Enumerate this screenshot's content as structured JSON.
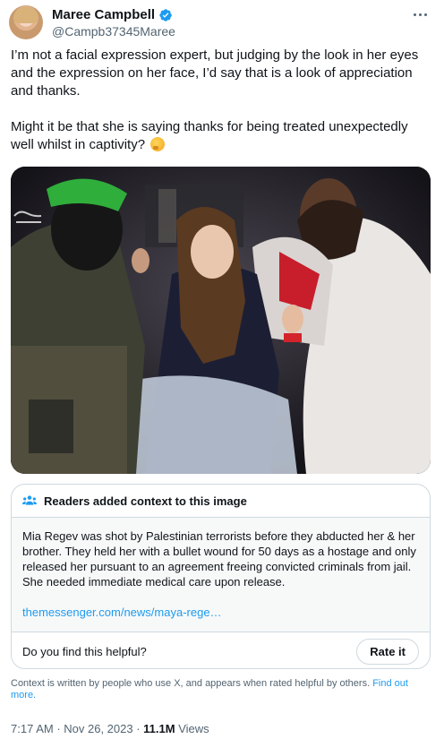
{
  "author": {
    "display_name": "Maree Campbell",
    "handle": "@Campb37345Maree",
    "verified": true
  },
  "icons": {
    "verified": "verified-badge-icon",
    "more": "more-options-icon",
    "note": "people-icon",
    "emoji": "thinking-face-emoji"
  },
  "tweet": {
    "text_p1": "I’m not a facial expression expert, but judging by the look in her eyes and the expression on her face, I’d say that is a look of appreciation and thanks.",
    "text_p2": "Might it be that she is saying thanks for being treated unexpectedly well whilst in captivity?"
  },
  "note": {
    "header": "Readers added context to this image",
    "body": "Mia Regev was shot by Palestinian terrorists before they abducted her & her brother. They held her with a bullet wound for 50 days as a hostage and only released her pursuant to an agreement freeing convicted criminals from jail. She needed immediate medical care upon release.",
    "link": "themessenger.com/news/maya-rege…",
    "helpful_question": "Do you find this helpful?",
    "rate_button": "Rate it"
  },
  "context_footer": {
    "text": "Context is written by people who use X, and appears when rated helpful by others.",
    "link": "Find out more."
  },
  "meta": {
    "time": "7:17 AM",
    "separator1": " · ",
    "date": "Nov 26, 2023",
    "separator2": " · ",
    "views_count": "11.1M",
    "views_label": " Views"
  },
  "colors": {
    "accent": "#1d9bf0",
    "text_primary": "#0f1419",
    "text_secondary": "#536471",
    "border": "#cfd9de"
  }
}
